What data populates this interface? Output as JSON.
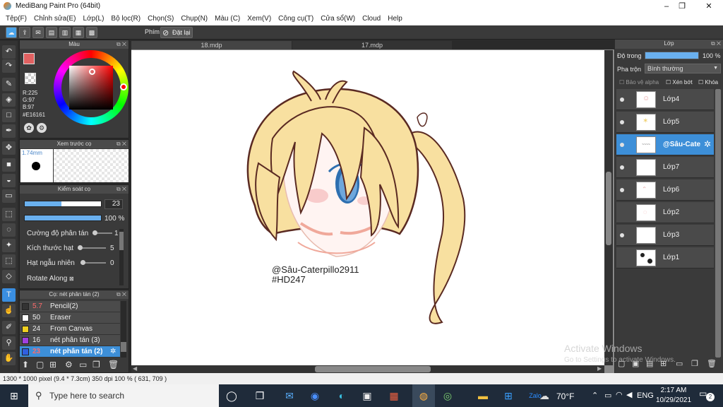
{
  "window": {
    "title": "MediBang Paint Pro (64bit)",
    "controls": [
      "–",
      "❐",
      "✕"
    ]
  },
  "menu": [
    "Tệp(F)",
    "Chỉnh sửa(E)",
    "Lớp(L)",
    "Bộ lọc(R)",
    "Chọn(S)",
    "Chụp(N)",
    "Màu (C)",
    "Xem(V)",
    "Công cụ(T)",
    "Cửa sổ(W)",
    "Cloud",
    "Help"
  ],
  "toolbar": {
    "phim_label": "Phím",
    "reset_label": "Đặt lại"
  },
  "color_panel": {
    "title": "Màu",
    "r": "R:225",
    "g": "G:97",
    "b": "B:97",
    "hex": "#E16161",
    "accent": "#E16161"
  },
  "preview_panel": {
    "title": "Xem trước cọ",
    "size": "1.74mm"
  },
  "brush_control": {
    "title": "Kiểm soát cọ",
    "size_value": "23",
    "size_fraction": 0.48,
    "opacity_value": "100 %",
    "opacity_fraction": 1.0,
    "rows": [
      {
        "label": "Cường độ phân tán",
        "value": "1"
      },
      {
        "label": "Kích thước hạt",
        "value": "5"
      },
      {
        "label": "Hạt ngẫu nhiên",
        "value": "0"
      },
      {
        "label": "Rotate Along",
        "value": "⊠"
      }
    ]
  },
  "brush_list": {
    "title": "Cọ: nét phân tán (2)",
    "items": [
      {
        "size": "5.7",
        "name": "Pencil(2)",
        "color": "#333333",
        "size_color": "#ff6b6b"
      },
      {
        "size": "50",
        "name": "Eraser",
        "color": "#ffffff",
        "size_color": "#eeeeee"
      },
      {
        "size": "24",
        "name": "From Canvas",
        "color": "#f0d020",
        "size_color": "#eeeeee"
      },
      {
        "size": "16",
        "name": "nét phân tán (3)",
        "color": "#a040e0",
        "size_color": "#eeeeee"
      },
      {
        "size": "23",
        "name": "nét phân tán (2)",
        "color": "#3060e0",
        "size_color": "#ff6b6b"
      }
    ]
  },
  "tabs": [
    "18.mdp",
    "17.mdp"
  ],
  "artwork": {
    "line1": "@Sâu-Caterpillo2911",
    "line2": "#HD247"
  },
  "layer_panel": {
    "title": "Lớp",
    "opacity_label": "Độ trong",
    "opacity_value": "100 %",
    "blend_label": "Pha trộn",
    "blend_value": "Bình thường",
    "alpha_label": "Bảo vệ alpha",
    "clip_label": "Xén bớt",
    "lock_label": "Khóa",
    "layers": [
      {
        "name": "Lớp4",
        "visible": true
      },
      {
        "name": "Lớp5",
        "visible": true
      },
      {
        "name": "@Sâu-Cate",
        "visible": true,
        "selected": true
      },
      {
        "name": "Lớp7",
        "visible": true
      },
      {
        "name": "Lớp6",
        "visible": true
      },
      {
        "name": "Lớp2",
        "visible": false
      },
      {
        "name": "Lớp3",
        "visible": true
      },
      {
        "name": "Lớp1",
        "visible": false
      }
    ]
  },
  "watermark": {
    "line1": "Activate Windows",
    "line2": "Go to Settings to activate Windows."
  },
  "status": {
    "text": "1300 * 1000 pixel   (9.4 * 7.3cm)   350 dpi   100 %   ( 631, 709 )"
  },
  "taskbar": {
    "search_placeholder": "Type here to search",
    "weather": "70°F",
    "lang": "ENG",
    "time": "2:17 AM",
    "date": "10/29/2021",
    "notif": "2"
  }
}
